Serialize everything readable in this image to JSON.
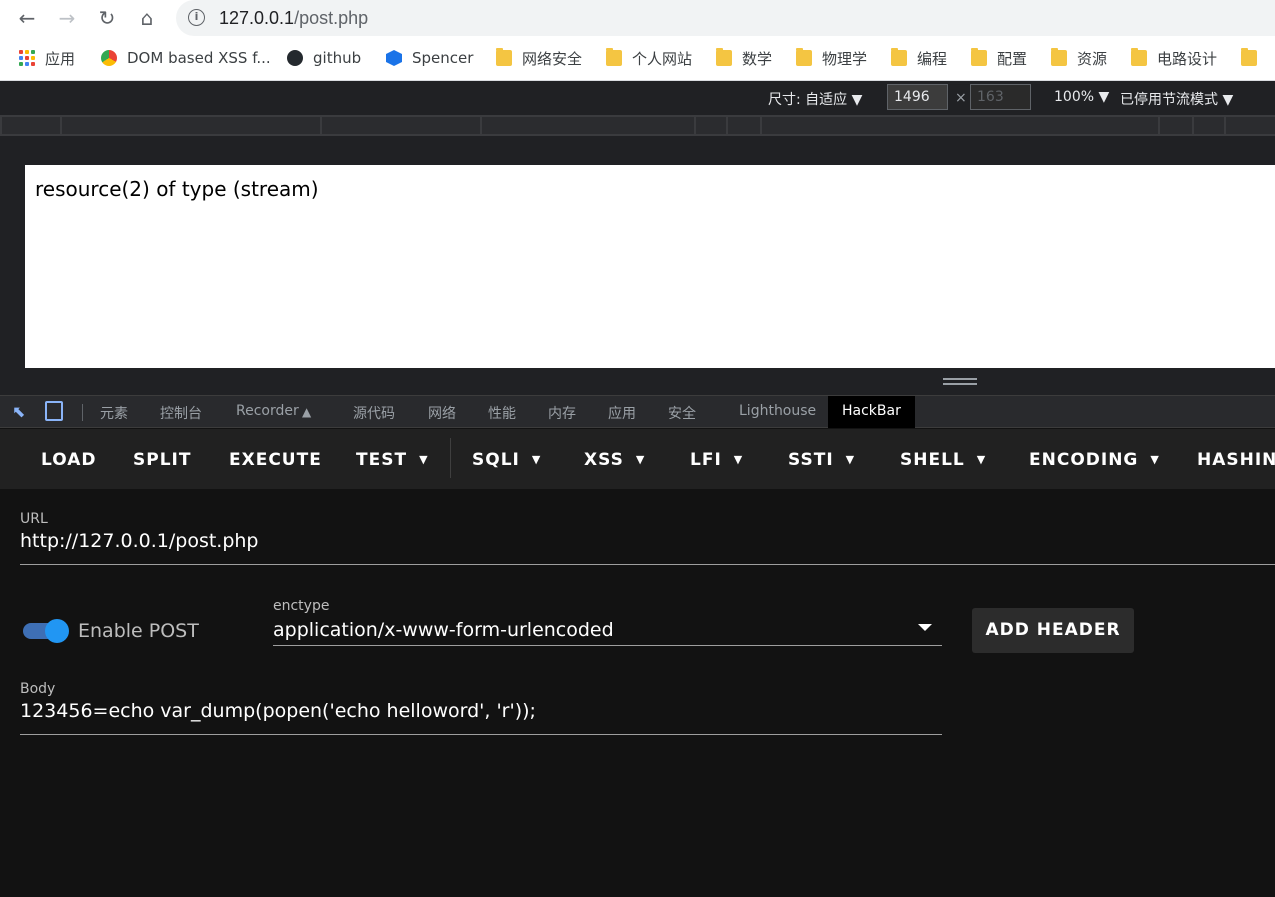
{
  "browser": {
    "url_host": "127.0.0.1",
    "url_path": "/post.php",
    "bookmarks": [
      {
        "label": "应用",
        "icon": "apps-icon"
      },
      {
        "label": "DOM based XSS f...",
        "icon": "chrome-icon"
      },
      {
        "label": "github",
        "icon": "github-icon"
      },
      {
        "label": "Spencer",
        "icon": "hexagon-h-icon"
      },
      {
        "label": "网络安全",
        "icon": "folder-icon"
      },
      {
        "label": "个人网站",
        "icon": "folder-icon"
      },
      {
        "label": "数学",
        "icon": "folder-icon"
      },
      {
        "label": "物理学",
        "icon": "folder-icon"
      },
      {
        "label": "编程",
        "icon": "folder-icon"
      },
      {
        "label": "配置",
        "icon": "folder-icon"
      },
      {
        "label": "资源",
        "icon": "folder-icon"
      },
      {
        "label": "电路设计",
        "icon": "folder-icon"
      }
    ]
  },
  "device_toolbar": {
    "size_label": "尺寸: 自适应 ▼",
    "width": "1496",
    "times": "×",
    "height": "163",
    "zoom": "100% ▼",
    "throttle": "已停用节流模式 ▼"
  },
  "page": {
    "output": "resource(2) of type (stream)"
  },
  "devtools": {
    "tabs": [
      "元素",
      "控制台",
      "Recorder",
      "源代码",
      "网络",
      "性能",
      "内存",
      "应用",
      "安全",
      "Lighthouse",
      "HackBar"
    ],
    "active_tab": "HackBar"
  },
  "hackbar": {
    "menu": {
      "load": "LOAD",
      "split": "SPLIT",
      "execute": "EXECUTE",
      "test": "TEST",
      "sqli": "SQLI",
      "xss": "XSS",
      "lfi": "LFI",
      "ssti": "SSTI",
      "shell": "SHELL",
      "encoding": "ENCODING",
      "hashing": "HASHING"
    },
    "url_label": "URL",
    "url_value": "http://127.0.0.1/post.php",
    "enable_post_label": "Enable POST",
    "enable_post": true,
    "enctype_label": "enctype",
    "enctype_value": "application/x-www-form-urlencoded",
    "add_header": "ADD HEADER",
    "body_label": "Body",
    "body_value": "123456=echo var_dump(popen('echo helloword', 'r'));"
  },
  "colors": {
    "toggle_on": "#2196f3",
    "hackbar_bg": "#121212",
    "menu_bg": "#212121"
  }
}
